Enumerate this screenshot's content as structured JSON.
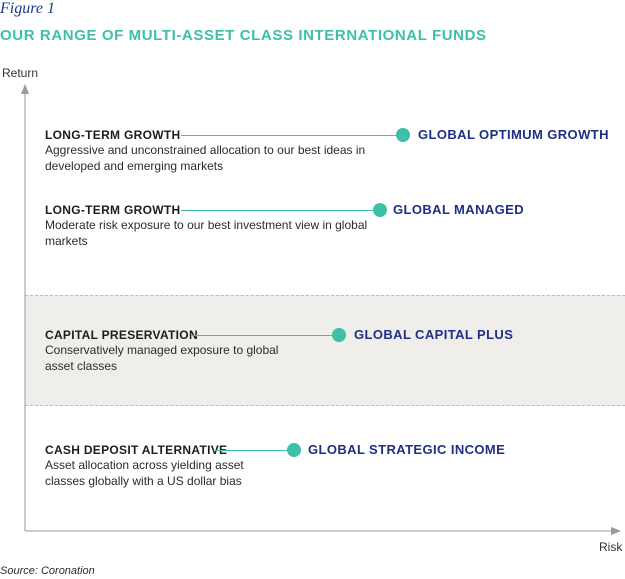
{
  "figure_label": "Figure 1",
  "title": "OUR RANGE OF MULTI-ASSET CLASS INTERNATIONAL FUNDS",
  "axes": {
    "y_label": "Return",
    "x_label": "Risk"
  },
  "items": [
    {
      "category": "LONG-TERM GROWTH",
      "description": "Aggressive and unconstrained allocation to our best ideas in developed and emerging markets",
      "fund": "GLOBAL OPTIMUM GROWTH"
    },
    {
      "category": "LONG-TERM GROWTH",
      "description": "Moderate risk exposure to our best investment view in global markets",
      "fund": "GLOBAL MANAGED"
    },
    {
      "category": "CAPITAL PRESERVATION",
      "description": "Conservatively managed exposure to global asset classes",
      "fund": "GLOBAL CAPITAL PLUS"
    },
    {
      "category": "CASH DEPOSIT ALTERNATIVE",
      "description": "Asset allocation across yielding asset classes globally with a US dollar bias",
      "fund": "GLOBAL STRATEGIC INCOME"
    }
  ],
  "source": "Source: Coronation",
  "colors": {
    "accent": "#3dbfa8",
    "fund_text": "#1f2f86",
    "band": "#efeeea"
  }
}
